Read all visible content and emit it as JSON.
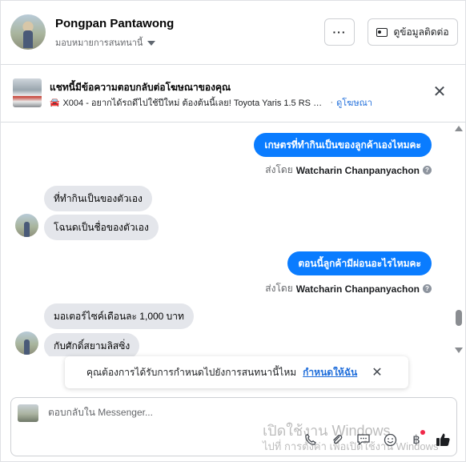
{
  "header": {
    "contact_name": "Pongpan Pantawong",
    "assign_label": "มอบหมายการสนทนานี้",
    "more_label": "···",
    "view_contact_label": "ดูข้อมูลติดต่อ"
  },
  "ad_banner": {
    "title": "แชทนี้มีข้อความตอบกลับต่อโฆษณาของคุณ",
    "ad_text": "X004 - อยากได้รถดีไปใช้ปีใหม่ ต้องต้นนี้เลย! Toyota Yaris 1.5 RS ตัวท็อ...",
    "separator": "·",
    "view_ad_link": "ดูโฆษณา"
  },
  "conversation": {
    "messages": [
      {
        "direction": "outgoing",
        "text": "เกษตรที่ทำกินเป็นของลูกค้าเองไหมคะ"
      },
      {
        "direction": "sent_by",
        "prefix": "ส่งโดย",
        "agent": "Watcharin Chanpanyachon"
      },
      {
        "direction": "incoming",
        "text": "ที่ทำกินเป็นของตัวเอง"
      },
      {
        "direction": "incoming",
        "text": "โฉนดเป็นชื่อของตัวเอง"
      },
      {
        "direction": "outgoing",
        "text": "ตอนนี้ลูกค้ามีผ่อนอะไรไหมคะ"
      },
      {
        "direction": "sent_by",
        "prefix": "ส่งโดย",
        "agent": "Watcharin Chanpanyachon"
      },
      {
        "direction": "incoming",
        "text": "มอเตอร์ไซค์เดือนละ 1,000 บาท"
      },
      {
        "direction": "incoming",
        "text": "กับศักดิ์สยามลิสซิ่ง"
      }
    ]
  },
  "reminder_toast": {
    "message": "คุณต้องการได้รับการกำหนดไปยังการสนทนานี้ไหม",
    "action": "กำหนดให้ฉัน"
  },
  "composer": {
    "placeholder": "ตอบกลับใน Messenger...",
    "tools": [
      "phone-icon",
      "attachment-icon",
      "saved-reply-icon",
      "emoji-icon",
      "baht-icon",
      "like-icon"
    ]
  },
  "watermark": {
    "line1": "เปิดใช้งาน Windows",
    "line2": "ไปที่ การตั้งค่า เพื่อเปิดใช้งาน Windows"
  },
  "colors": {
    "accent": "#0a7cff",
    "link": "#216fdb",
    "incoming_bubble": "#e4e6eb",
    "notification_dot": "#f02849"
  }
}
